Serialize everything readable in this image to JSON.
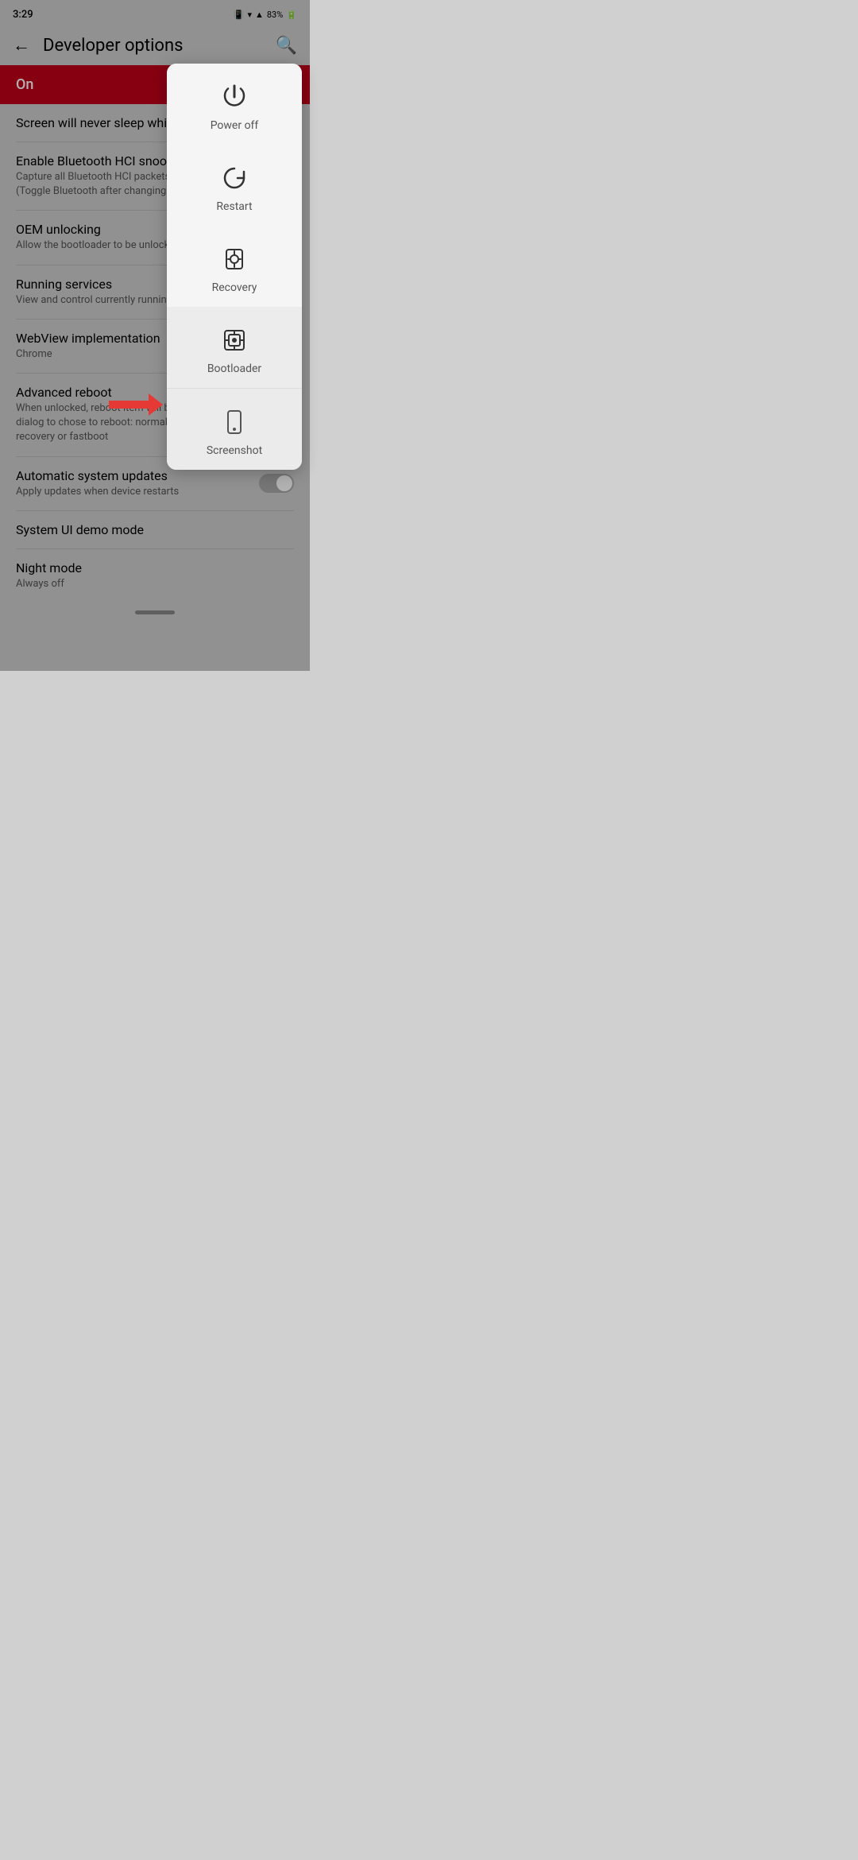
{
  "statusBar": {
    "time": "3:29",
    "battery": "83%"
  },
  "header": {
    "title": "Developer options",
    "backIcon": "←",
    "searchIcon": "🔍"
  },
  "onBanner": {
    "label": "On",
    "subtitle": "Screen will never sleep while chargi..."
  },
  "settings": [
    {
      "title": "Enable Bluetooth HCI snoop lo...",
      "subtitle": "Capture all Bluetooth HCI packets in a...\n(Toggle Bluetooth after changing this s..."
    },
    {
      "title": "OEM unlocking",
      "subtitle": "Allow the bootloader to be unlocke..."
    },
    {
      "title": "Running services",
      "subtitle": "View and control currently running ser..."
    },
    {
      "title": "WebView implementation",
      "subtitle": "Chrome"
    },
    {
      "title": "Advanced reboot",
      "subtitle": "When unlocked, reboot item will bring...\ndialog to chose to reboot: normally, into\nrecovery or fastboot"
    },
    {
      "title": "Automatic system updates",
      "subtitle": "Apply updates when device restarts",
      "hasToggle": true
    },
    {
      "title": "System UI demo mode",
      "subtitle": ""
    },
    {
      "title": "Night mode",
      "subtitle": "Always off"
    }
  ],
  "powerMenu": {
    "items": [
      {
        "id": "power-off",
        "label": "Power off",
        "iconType": "power"
      },
      {
        "id": "restart",
        "label": "Restart",
        "iconType": "restart"
      },
      {
        "id": "recovery",
        "label": "Recovery",
        "iconType": "recovery"
      },
      {
        "id": "bootloader",
        "label": "Bootloader",
        "iconType": "bootloader",
        "highlighted": true
      },
      {
        "id": "screenshot",
        "label": "Screenshot",
        "iconType": "screenshot",
        "section": "last"
      }
    ]
  }
}
